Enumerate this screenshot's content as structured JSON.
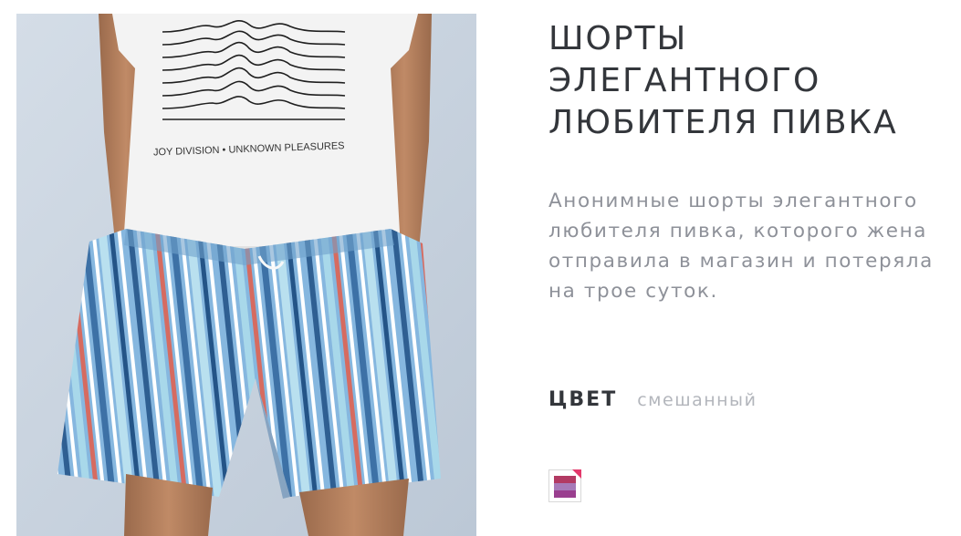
{
  "product": {
    "title": "ШОРТЫ ЭЛЕГАНТНОГО ЛЮБИТЕЛЯ ПИВКА",
    "description": "Анонимные шорты элегантного любителя пивка, которого жена отправила в магазин и потеряла на трое суток.",
    "color_label": "ЦВЕТ",
    "color_value": "смешанный",
    "tshirt_print_text": "JOY DIVISION • UNKNOWN PLEASURES"
  },
  "swatch": {
    "stripe_colors": [
      "#b23a63",
      "#a77ab8",
      "#9a3f8f"
    ],
    "corner_color": "#e3386b"
  }
}
